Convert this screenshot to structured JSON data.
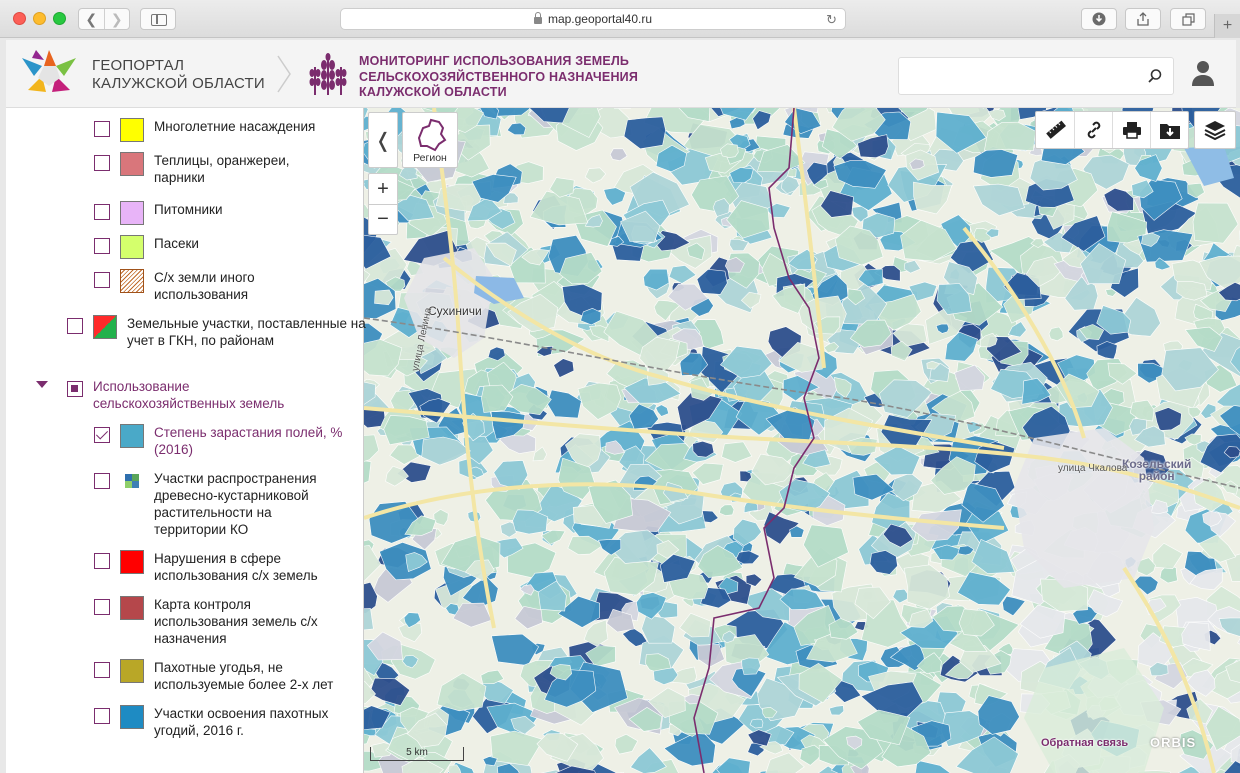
{
  "browser": {
    "url": "map.geoportal40.ru",
    "back_icon": "chevron-left-icon",
    "forward_icon": "chevron-right-icon"
  },
  "header": {
    "portal_name_line1": "ГЕОПОРТАЛ",
    "portal_name_line2": "КАЛУЖСКОЙ ОБЛАСТИ",
    "project_line1": "МОНИТОРИНГ ИСПОЛЬЗОВАНИЯ ЗЕМЕЛЬ",
    "project_line2": "СЕЛЬСКОХОЗЯЙСТВЕННОГО НАЗНАЧЕНИЯ",
    "project_line3": "КАЛУЖСКОЙ ОБЛАСТИ",
    "search_placeholder": "",
    "accent_color": "#7b2d6e"
  },
  "map_controls": {
    "collapse_label": "❬",
    "region_label": "Регион",
    "zoom_in": "+",
    "zoom_out": "−",
    "tools": [
      "ruler-icon",
      "link-icon",
      "print-icon",
      "download-icon"
    ],
    "layers_icon": "layers-icon"
  },
  "map": {
    "city_label": "Сухиничи",
    "district_label_line1": "Козельский",
    "district_label_line2": "район",
    "street_1": "улица Ленина",
    "street_2": "улица Чкалова",
    "scale_label": "5 km",
    "feedback": "Обратная связь",
    "brand": "ORBIS"
  },
  "legend": [
    {
      "label": "Многолетние насаждения",
      "color": "#ffff00",
      "checked": false
    },
    {
      "label": "Теплицы, оранжереи, парники",
      "color": "#d9767b",
      "checked": false
    },
    {
      "label": "Питомники",
      "color": "#e8b4f8",
      "checked": false
    },
    {
      "label": "Пасеки",
      "color": "#d4ff6c",
      "checked": false
    },
    {
      "label": "С/х земли иного использования",
      "color": "hatched",
      "checked": false
    },
    {
      "label": "Земельные участки, поставленные на учет в ГКН, по районам",
      "color": "split-red-green",
      "checked": false
    },
    {
      "label": "Использование сельскохозяйственных земель",
      "group": true,
      "checked": "partial"
    },
    {
      "label": "Степень зарастания полей, % (2016)",
      "color": "#4aa9c8",
      "checked": true
    },
    {
      "label": "Участки распространения древесно-кустарниковой растительности на территории КО",
      "color": "mosaic",
      "checked": false
    },
    {
      "label": "Нарушения в сфере использования с/х земель",
      "color": "#ff0000",
      "checked": false
    },
    {
      "label": "Карта контроля использования земель с/х назначения",
      "color": "#b5474b",
      "checked": false
    },
    {
      "label": "Пахотные угодья, не используемые более 2-х лет",
      "color": "#b9a727",
      "checked": false
    },
    {
      "label": "Участки освоения пахотных угодий, 2016 г.",
      "color": "#1e8bc3",
      "checked": false
    }
  ]
}
